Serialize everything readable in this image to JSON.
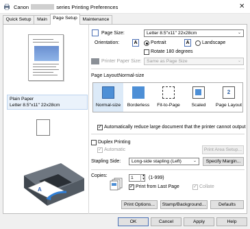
{
  "window": {
    "title_prefix": "Canon",
    "title_suffix": "series Printing Preferences",
    "close_glyph": "✕"
  },
  "tabs": [
    {
      "label": "Quick Setup"
    },
    {
      "label": "Main"
    },
    {
      "label": "Page Setup"
    },
    {
      "label": "Maintenance"
    }
  ],
  "preview": {
    "media": "Plain Paper",
    "size": "Letter 8.5\"x11\" 22x28cm"
  },
  "page_size": {
    "label": "Page Size:",
    "value": "Letter 8.5\"x11\" 22x28cm"
  },
  "orientation": {
    "label": "Orientation:",
    "portrait": "Portrait",
    "landscape": "Landscape",
    "rotate": "Rotate 180 degrees",
    "icon_glyph": "A"
  },
  "printer_paper_size": {
    "label": "Printer Paper Size:",
    "value": "Same as Page Size"
  },
  "page_layout": {
    "label": "Page Layout:",
    "value": "Normal-size",
    "options": [
      "Normal-size",
      "Borderless",
      "Fit-to-Page",
      "Scaled",
      "Page Layout"
    ],
    "page_layout_number": "2"
  },
  "auto_reduce": {
    "label": "Automatically reduce large document that the printer cannot output",
    "checked": true
  },
  "duplex": {
    "label": "Duplex Printing",
    "automatic": "Automatic",
    "print_area_button": "Print Area Setup..."
  },
  "stapling": {
    "label": "Stapling Side:",
    "value": "Long-side stapling (Left)",
    "margin_button": "Specify Margin..."
  },
  "copies": {
    "label": "Copies:",
    "value": "1",
    "range": "(1-999)",
    "last_page": "Print from Last Page",
    "collate": "Collate",
    "check_glyph": "✓"
  },
  "bottom_buttons": {
    "print_options": "Print Options...",
    "stamp_background": "Stamp/Background...",
    "defaults": "Defaults"
  },
  "dialog_buttons": {
    "ok": "OK",
    "cancel": "Cancel",
    "apply": "Apply",
    "help": "Help"
  },
  "colors": {
    "accent": "#4a6fb5",
    "selection": "#eaf2fb"
  }
}
